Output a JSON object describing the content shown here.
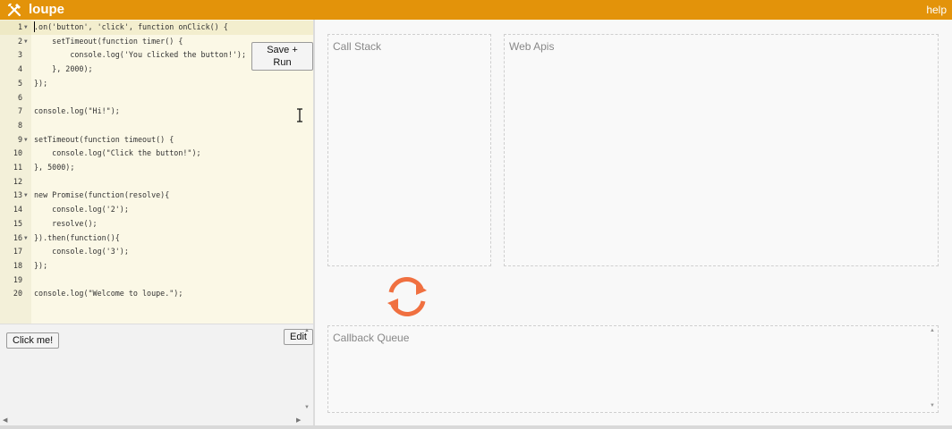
{
  "app": {
    "title": "loupe",
    "help": "help",
    "accent": "#e3930a"
  },
  "editor": {
    "save_run_label": "Save + Run",
    "lines": [
      {
        "num": "1",
        "fold": true,
        "text": ".on('button', 'click', function onClick() {"
      },
      {
        "num": "2",
        "fold": true,
        "text": "    setTimeout(function timer() {"
      },
      {
        "num": "3",
        "fold": false,
        "text": "        console.log('You clicked the button!');"
      },
      {
        "num": "4",
        "fold": false,
        "text": "    }, 2000);"
      },
      {
        "num": "5",
        "fold": false,
        "text": "});"
      },
      {
        "num": "6",
        "fold": false,
        "text": ""
      },
      {
        "num": "7",
        "fold": false,
        "text": "console.log(\"Hi!\");"
      },
      {
        "num": "8",
        "fold": false,
        "text": ""
      },
      {
        "num": "9",
        "fold": true,
        "text": "setTimeout(function timeout() {"
      },
      {
        "num": "10",
        "fold": false,
        "text": "    console.log(\"Click the button!\");"
      },
      {
        "num": "11",
        "fold": false,
        "text": "}, 5000);"
      },
      {
        "num": "12",
        "fold": false,
        "text": ""
      },
      {
        "num": "13",
        "fold": true,
        "text": "new Promise(function(resolve){"
      },
      {
        "num": "14",
        "fold": false,
        "text": "    console.log('2');"
      },
      {
        "num": "15",
        "fold": false,
        "text": "    resolve();"
      },
      {
        "num": "16",
        "fold": true,
        "text": "}).then(function(){"
      },
      {
        "num": "17",
        "fold": false,
        "text": "    console.log('3');"
      },
      {
        "num": "18",
        "fold": false,
        "text": "});"
      },
      {
        "num": "19",
        "fold": false,
        "text": ""
      },
      {
        "num": "20",
        "fold": false,
        "text": "console.log(\"Welcome to loupe.\");"
      }
    ]
  },
  "output": {
    "click_me_label": "Click me!",
    "edit_label": "Edit"
  },
  "panels": {
    "call_stack": "Call Stack",
    "web_apis": "Web Apis",
    "callback_queue": "Callback Queue"
  },
  "icons": {
    "logo": "crossed-tools-icon",
    "event_loop": "refresh-cycle-icon",
    "loop_color": "#f07040"
  }
}
